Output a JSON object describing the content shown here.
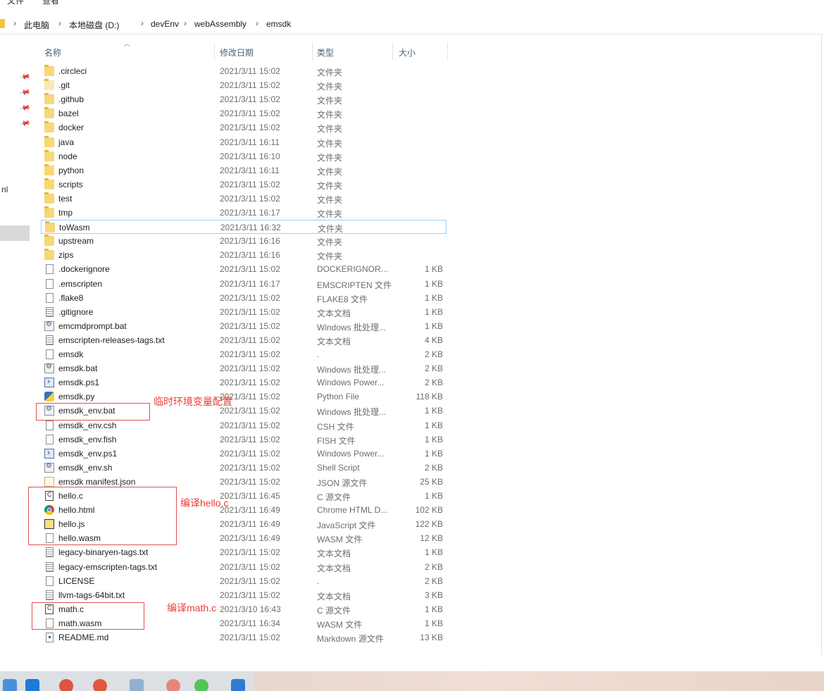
{
  "menu": {
    "items": [
      "文件",
      "查看"
    ]
  },
  "breadcrumb": {
    "items": [
      "此电脑",
      "本地磁盘 (D:)",
      "devEnv",
      "webAssembly",
      "emsdk"
    ]
  },
  "columns": {
    "name": "名称",
    "date": "修改日期",
    "type": "类型",
    "size": "大小"
  },
  "nav": {
    "partial_label": "nl"
  },
  "files": [
    {
      "name": ".circleci",
      "date": "2021/3/11 15:02",
      "type": "文件夹",
      "size": "",
      "icon": "folder-icon"
    },
    {
      "name": ".git",
      "date": "2021/3/11 15:02",
      "type": "文件夹",
      "size": "",
      "icon": "hidden-folder-icon"
    },
    {
      "name": ".github",
      "date": "2021/3/11 15:02",
      "type": "文件夹",
      "size": "",
      "icon": "folder-icon"
    },
    {
      "name": "bazel",
      "date": "2021/3/11 15:02",
      "type": "文件夹",
      "size": "",
      "icon": "folder-icon"
    },
    {
      "name": "docker",
      "date": "2021/3/11 15:02",
      "type": "文件夹",
      "size": "",
      "icon": "folder-icon"
    },
    {
      "name": "java",
      "date": "2021/3/11 16:11",
      "type": "文件夹",
      "size": "",
      "icon": "folder-icon"
    },
    {
      "name": "node",
      "date": "2021/3/11 16:10",
      "type": "文件夹",
      "size": "",
      "icon": "folder-icon"
    },
    {
      "name": "python",
      "date": "2021/3/11 16:11",
      "type": "文件夹",
      "size": "",
      "icon": "folder-icon"
    },
    {
      "name": "scripts",
      "date": "2021/3/11 15:02",
      "type": "文件夹",
      "size": "",
      "icon": "folder-icon"
    },
    {
      "name": "test",
      "date": "2021/3/11 15:02",
      "type": "文件夹",
      "size": "",
      "icon": "folder-icon"
    },
    {
      "name": "tmp",
      "date": "2021/3/11 16:17",
      "type": "文件夹",
      "size": "",
      "icon": "folder-icon"
    },
    {
      "name": "toWasm",
      "date": "2021/3/11 16:32",
      "type": "文件夹",
      "size": "",
      "icon": "folder-icon"
    },
    {
      "name": "upstream",
      "date": "2021/3/11 16:16",
      "type": "文件夹",
      "size": "",
      "icon": "folder-icon"
    },
    {
      "name": "zips",
      "date": "2021/3/11 16:16",
      "type": "文件夹",
      "size": "",
      "icon": "folder-icon"
    },
    {
      "name": ".dockerignore",
      "date": "2021/3/11 15:02",
      "type": "DOCKERIGNOR...",
      "size": "1 KB",
      "icon": "file-icon"
    },
    {
      "name": ".emscripten",
      "date": "2021/3/11 16:17",
      "type": "EMSCRIPTEN 文件",
      "size": "1 KB",
      "icon": "file-icon"
    },
    {
      "name": ".flake8",
      "date": "2021/3/11 15:02",
      "type": "FLAKE8 文件",
      "size": "1 KB",
      "icon": "file-icon"
    },
    {
      "name": ".gitignore",
      "date": "2021/3/11 15:02",
      "type": "文本文档",
      "size": "1 KB",
      "icon": "text-file-icon"
    },
    {
      "name": "emcmdprompt.bat",
      "date": "2021/3/11 15:02",
      "type": "Windows 批处理...",
      "size": "1 KB",
      "icon": "batch-file-icon"
    },
    {
      "name": "emscripten-releases-tags.txt",
      "date": "2021/3/11 15:02",
      "type": "文本文档",
      "size": "4 KB",
      "icon": "text-file-icon"
    },
    {
      "name": "emsdk",
      "date": "2021/3/11 15:02",
      "type": ".",
      "size": "2 KB",
      "icon": "file-icon"
    },
    {
      "name": "emsdk.bat",
      "date": "2021/3/11 15:02",
      "type": "Windows 批处理...",
      "size": "2 KB",
      "icon": "batch-file-icon"
    },
    {
      "name": "emsdk.ps1",
      "date": "2021/3/11 15:02",
      "type": "Windows Power...",
      "size": "2 KB",
      "icon": "powershell-file-icon"
    },
    {
      "name": "emsdk.py",
      "date": "2021/3/11 15:02",
      "type": "Python File",
      "size": "118 KB",
      "icon": "python-file-icon"
    },
    {
      "name": "emsdk_env.bat",
      "date": "2021/3/11 15:02",
      "type": "Windows 批处理...",
      "size": "1 KB",
      "icon": "batch-file-icon"
    },
    {
      "name": "emsdk_env.csh",
      "date": "2021/3/11 15:02",
      "type": "CSH 文件",
      "size": "1 KB",
      "icon": "file-icon"
    },
    {
      "name": "emsdk_env.fish",
      "date": "2021/3/11 15:02",
      "type": "FISH 文件",
      "size": "1 KB",
      "icon": "file-icon"
    },
    {
      "name": "emsdk_env.ps1",
      "date": "2021/3/11 15:02",
      "type": "Windows Power...",
      "size": "1 KB",
      "icon": "powershell-file-icon"
    },
    {
      "name": "emsdk_env.sh",
      "date": "2021/3/11 15:02",
      "type": "Shell Script",
      "size": "2 KB",
      "icon": "batch-file-icon"
    },
    {
      "name": "emsdk manifest.json",
      "date": "2021/3/11 15:02",
      "type": "JSON 源文件",
      "size": "25 KB",
      "icon": "json-file-icon"
    },
    {
      "name": "hello.c",
      "date": "2021/3/11 16:45",
      "type": "C 源文件",
      "size": "1 KB",
      "icon": "c-file-icon"
    },
    {
      "name": "hello.html",
      "date": "2021/3/11 16:49",
      "type": "Chrome HTML D...",
      "size": "102 KB",
      "icon": "chrome-icon"
    },
    {
      "name": "hello.js",
      "date": "2021/3/11 16:49",
      "type": "JavaScript 文件",
      "size": "122 KB",
      "icon": "javascript-file-icon"
    },
    {
      "name": "hello.wasm",
      "date": "2021/3/11 16:49",
      "type": "WASM 文件",
      "size": "12 KB",
      "icon": "file-icon"
    },
    {
      "name": "legacy-binaryen-tags.txt",
      "date": "2021/3/11 15:02",
      "type": "文本文档",
      "size": "1 KB",
      "icon": "text-file-icon"
    },
    {
      "name": "legacy-emscripten-tags.txt",
      "date": "2021/3/11 15:02",
      "type": "文本文档",
      "size": "2 KB",
      "icon": "text-file-icon"
    },
    {
      "name": "LICENSE",
      "date": "2021/3/11 15:02",
      "type": ".",
      "size": "2 KB",
      "icon": "file-icon"
    },
    {
      "name": "llvm-tags-64bit.txt",
      "date": "2021/3/11 15:02",
      "type": "文本文档",
      "size": "3 KB",
      "icon": "text-file-icon"
    },
    {
      "name": "math.c",
      "date": "2021/3/10 16:43",
      "type": "C 源文件",
      "size": "1 KB",
      "icon": "c-file-icon"
    },
    {
      "name": "math.wasm",
      "date": "2021/3/11 16:34",
      "type": "WASM 文件",
      "size": "1 KB",
      "icon": "file-icon"
    },
    {
      "name": "README.md",
      "date": "2021/3/11 15:02",
      "type": "Markdown 源文件",
      "size": "13 KB",
      "icon": "markdown-file-icon"
    }
  ],
  "annotations": {
    "env_note": "临时环境变量配置",
    "hello_note": "编译hello.c",
    "math_note": "编译math.c",
    "color": "#ee3b3b"
  },
  "taskbar": {
    "icons": [
      "file-explorer-icon",
      "vscode-icon",
      "chrome-icon",
      "chrome-canary-icon",
      "recycle-icon",
      "paint-icon",
      "wechat-icon",
      "taskbar-app-icon"
    ]
  }
}
